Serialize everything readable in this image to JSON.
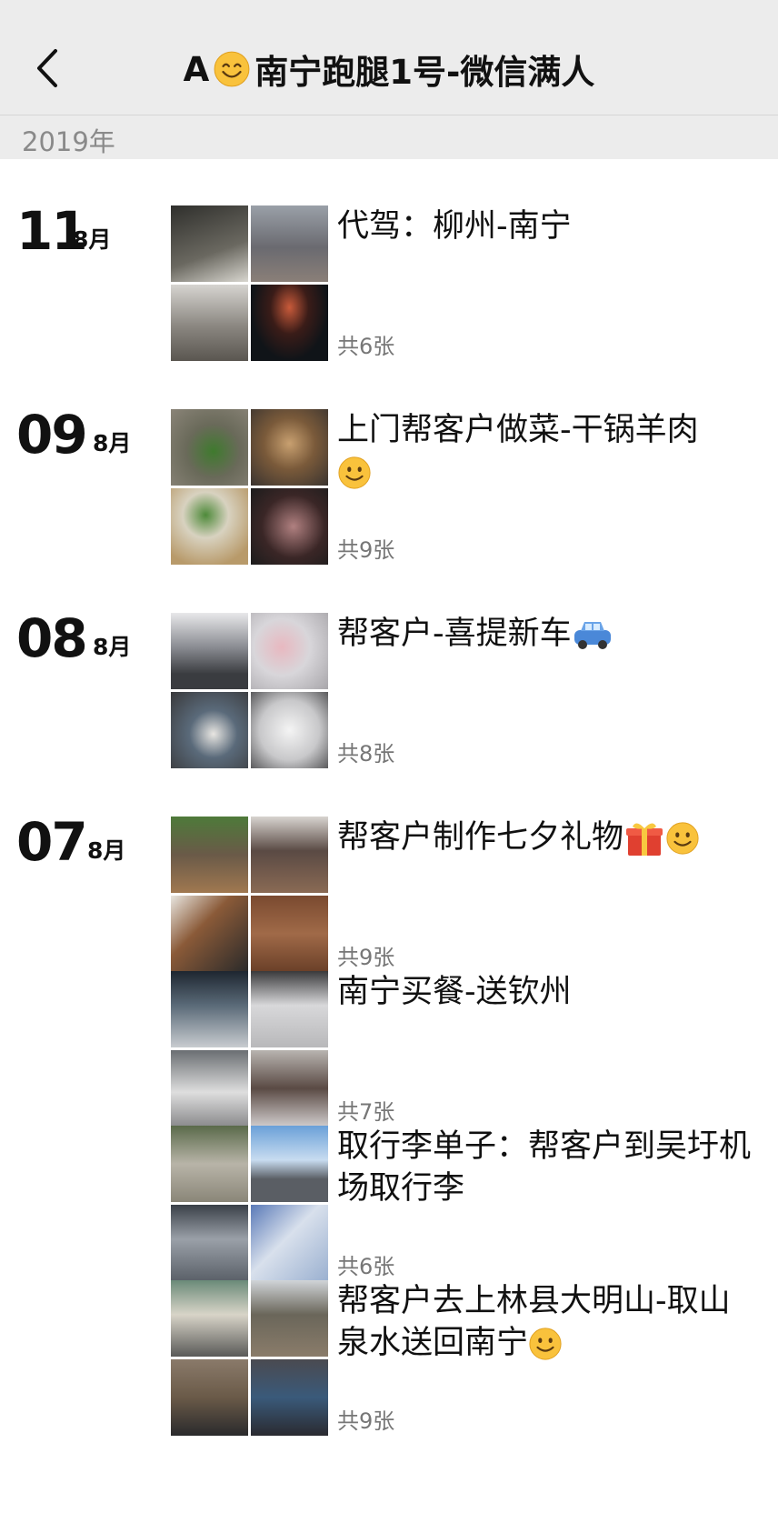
{
  "header": {
    "title_prefix": "A",
    "title_main": "南宁跑腿1号-微信满人"
  },
  "year": "2019年",
  "entries": [
    {
      "day": "11",
      "month": "8月",
      "posts": [
        {
          "text": "代驾：柳州-南宁",
          "count": "共6张",
          "thumbs": [
            "#4a4a46",
            "#7d7f85",
            "#9a9690",
            "#23262e"
          ]
        }
      ]
    },
    {
      "day": "09",
      "month": "8月",
      "posts": [
        {
          "text": "上门帮客户做菜-干锅羊肉",
          "count": "共9张",
          "thumbs": [
            "#6b6a5c",
            "#8a6a4c",
            "#b7ab8c",
            "#3a2c2a"
          ]
        }
      ]
    },
    {
      "day": "08",
      "month": "8月",
      "posts": [
        {
          "text": "帮客户-喜提新车",
          "count": "共8张",
          "thumbs": [
            "#8b8c92",
            "#c7c5c9",
            "#6e6a66",
            "#e8e8e9"
          ]
        }
      ]
    },
    {
      "day": "07",
      "month": "8月",
      "posts": [
        {
          "text": "帮客户制作七夕礼物",
          "count": "共9张",
          "thumbs": [
            "#5d6b45",
            "#6a5550",
            "#5a4a3e",
            "#7a5c42"
          ]
        },
        {
          "text": "南宁买餐-送钦州",
          "count": "共7张",
          "thumbs": [
            "#3a4046",
            "#c9c9cc",
            "#6e6e72",
            "#8f8a86"
          ]
        },
        {
          "text": "取行李单子：帮客户到吴圩机场取行李",
          "count": "共6张",
          "thumbs": [
            "#6e6c60",
            "#8aa8c8",
            "#5a6068",
            "#a8b4c8"
          ]
        },
        {
          "text": "帮客户去上林县大明山-取山泉水送回南宁",
          "count": "共9张",
          "thumbs": [
            "#7a8a84",
            "#6a665a",
            "#6a5a48",
            "#4a4a50"
          ]
        }
      ]
    }
  ],
  "icons": {
    "back": "chevron-left-icon",
    "smile": "smile-emoji-icon",
    "car": "car-emoji-icon",
    "gift": "gift-emoji-icon"
  }
}
